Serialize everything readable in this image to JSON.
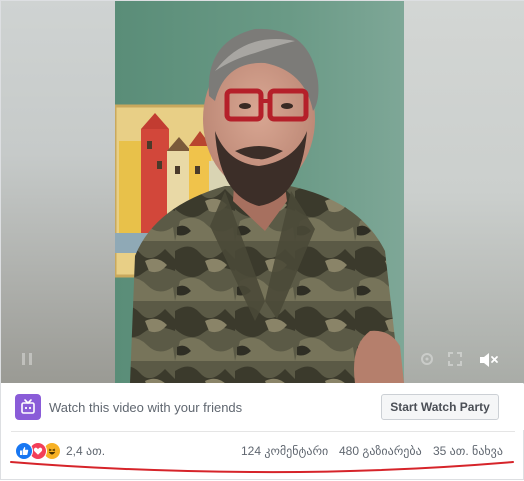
{
  "watch_party": {
    "prompt": "Watch this video with your friends",
    "button_label": "Start Watch Party",
    "icon": "watch-party-icon",
    "icon_color": "#8a5cd8"
  },
  "stats": {
    "reactions": [
      "like",
      "love",
      "haha"
    ],
    "reaction_count": "2,4 ათ.",
    "comments": "124 კომენტარი",
    "shares": "480 გაზიარება",
    "views": "35 ათ. ნახვა"
  },
  "video": {
    "mute_icon": "volume-muted-icon"
  },
  "colors": {
    "like": "#1877f2",
    "love": "#f33e58",
    "haha": "#f7b125",
    "annotation": "#d6242a"
  }
}
